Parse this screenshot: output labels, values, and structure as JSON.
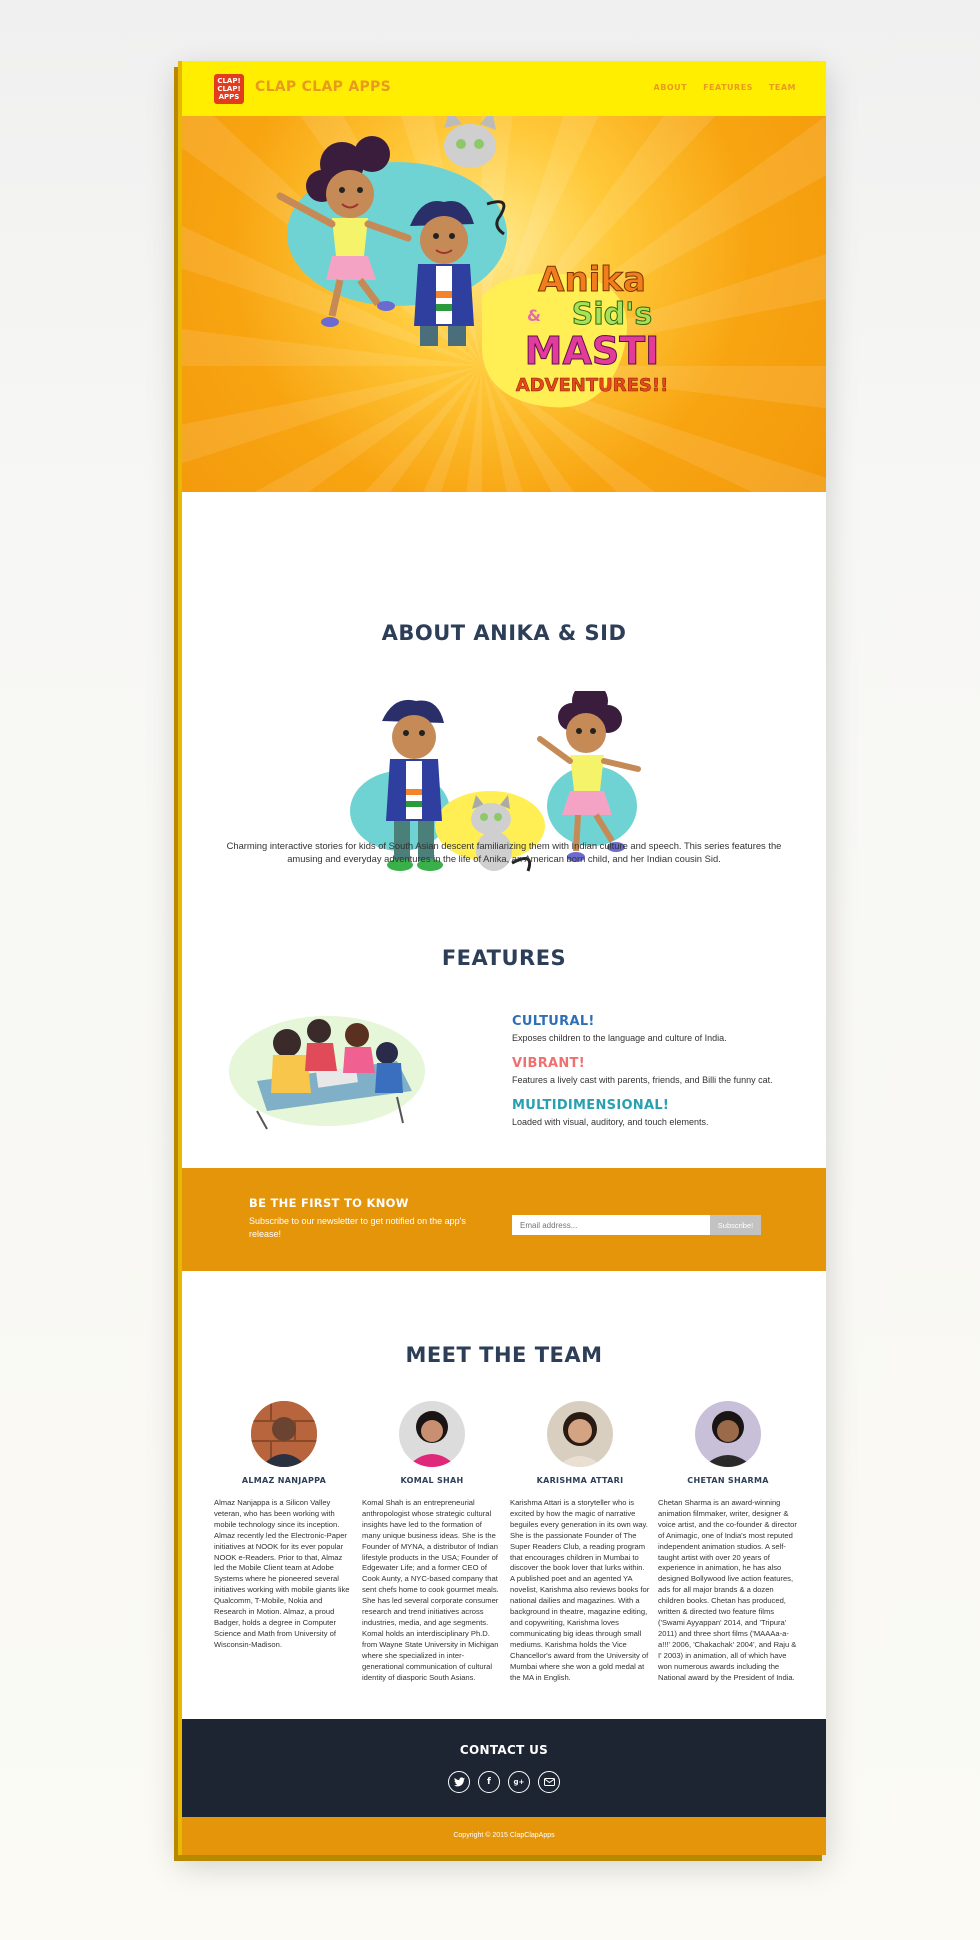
{
  "nav": {
    "logo_text": [
      "CLAP!",
      "CLAP!",
      "APPS"
    ],
    "brand": "CLAP CLAP APPS",
    "links": [
      "ABOUT",
      "FEATURES",
      "TEAM"
    ]
  },
  "hero": {
    "title_line1": "Anika",
    "title_amp": "&",
    "title_line2": "Sid's",
    "title_line3": "MASTI",
    "title_line4": "ADVENTURES!!"
  },
  "about": {
    "title": "ABOUT ANIKA & SID",
    "description": "Charming interactive stories for kids of South Asian descent familiarizing them with Indian culture and speech. This series features the amusing and everyday adventures in the life of Anika, an American born child, and her Indian cousin Sid."
  },
  "features": {
    "title": "FEATURES",
    "items": [
      {
        "title": "CULTURAL!",
        "text": "Exposes children to the language and culture of India.",
        "color": "#2e6fb6"
      },
      {
        "title": "VIBRANT!",
        "text": "Features a lively cast with parents, friends, and Billi the funny cat.",
        "color": "#f07070"
      },
      {
        "title": "MULTIDIMENSIONAL!",
        "text": "Loaded with visual, auditory, and touch elements.",
        "color": "#29a0b1"
      }
    ]
  },
  "newsletter": {
    "heading": "BE THE FIRST TO KNOW",
    "subtext": "Subscribe to our newsletter to get notified on the app's release!",
    "placeholder": "Email address...",
    "button": "Subscribe!"
  },
  "team": {
    "title": "MEET THE TEAM",
    "members": [
      {
        "name": "ALMAZ NANJAPPA",
        "bio": "Almaz Nanjappa is a Silicon Valley veteran, who has been working with mobile technology since its inception. Almaz recently led the Electronic-Paper initiatives at NOOK for its ever popular NOOK e-Readers. Prior to that, Almaz led the Mobile Client team at Adobe Systems where he pioneered several initiatives working with mobile giants like Qualcomm, T-Mobile, Nokia and Research in Motion. Almaz, a proud Badger, holds a degree in Computer Science and Math from University of Wisconsin-Madison."
      },
      {
        "name": "KOMAL SHAH",
        "bio": "Komal Shah is an entrepreneurial anthropologist whose strategic cultural insights have led to the formation of many unique business ideas. She is the Founder of MYNA, a distributor of Indian lifestyle products in the USA; Founder of Edgewater Life; and a former CEO of Cook Aunty, a NYC-based company that sent chefs home to cook gourmet meals. She has led several corporate consumer research and trend initiatives across industries, media, and age segments. Komal holds an interdisciplinary Ph.D. from Wayne State University in Michigan where she specialized in inter-generational communication of cultural identity of diasporic South Asians."
      },
      {
        "name": "KARISHMA ATTARI",
        "bio": "Karishma Attari is a storyteller who is excited by how the magic of narrative beguiles every generation in its own way. She is the passionate Founder of The Super Readers Club, a reading program that encourages children in Mumbai to discover the book lover that lurks within. A published poet and an agented YA novelist, Karishma also reviews books for national dailies and magazines. With a background in theatre, magazine editing, and copywriting, Karishma loves communicating big ideas through small mediums. Karishma holds the Vice Chancellor's award from the University of Mumbai where she won a gold medal at the MA in English."
      },
      {
        "name": "CHETAN SHARMA",
        "bio": "Chetan Sharma is an award-winning animation filmmaker, writer, designer & voice artist, and the co-founder & director of Animagic, one of India's most reputed independent animation studios. A self-taught artist with over 20 years of experience in animation, he has also designed Bollywood live action features, ads for all major brands & a dozen children books. Chetan has produced, written & directed two feature films ('Swami Ayyappan' 2014, and 'Tripura' 2011) and three short films ('MAAAa-a-a!!!' 2006, 'Chakachak' 2004', and Raju & I' 2003) in animation, all of which have won numerous awards including the National award by the President of India."
      }
    ]
  },
  "contact": {
    "title": "CONTACT US",
    "icons": [
      "twitter-icon",
      "facebook-icon",
      "google-plus-icon",
      "email-icon"
    ]
  },
  "footer": {
    "copyright": "Copyright © 2015 ClapClapApps"
  }
}
